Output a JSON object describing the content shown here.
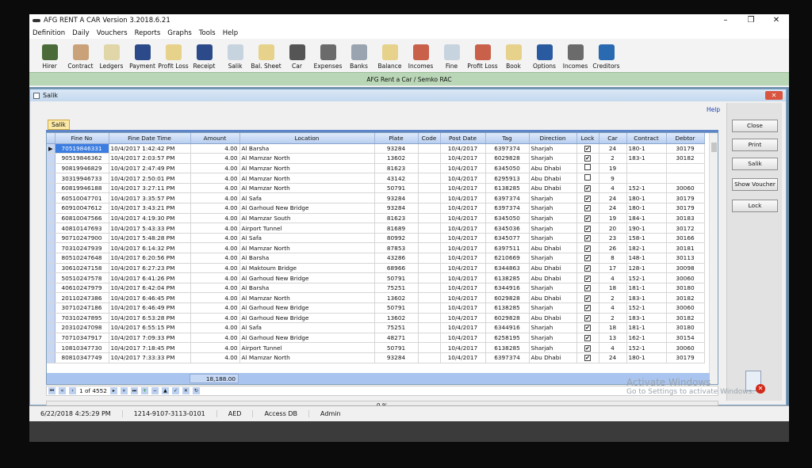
{
  "window": {
    "title": "AFG RENT A CAR Version 3.2018.6.21",
    "minimize": "–",
    "maximize": "❐",
    "close": "✕"
  },
  "menu": [
    "Definition",
    "Daily",
    "Vouchers",
    "Reports",
    "Graphs",
    "Tools",
    "Help"
  ],
  "toolbar": [
    {
      "label": "Hirer",
      "icon": "hirer-icon",
      "color": "#4a6a3a"
    },
    {
      "label": "Contract",
      "icon": "handshake-icon",
      "color": "#c9a27a"
    },
    {
      "label": "Ledgers",
      "icon": "ledger-icon",
      "color": "#e0d6a8"
    },
    {
      "label": "Payment",
      "icon": "payment-icon",
      "color": "#2c4a8a"
    },
    {
      "label": "Profit Loss",
      "icon": "folder-icon",
      "color": "#e6d28a"
    },
    {
      "label": "Receipt",
      "icon": "receipt-icon",
      "color": "#2c4a8a"
    },
    {
      "label": "Salik",
      "icon": "salik-icon",
      "color": "#c8d3e0"
    },
    {
      "label": "Bal. Sheet",
      "icon": "folder-icon",
      "color": "#e6d28a"
    },
    {
      "label": "Car",
      "icon": "car-icon",
      "color": "#555555"
    },
    {
      "label": "Expenses",
      "icon": "expenses-icon",
      "color": "#6b6b6b"
    },
    {
      "label": "Banks",
      "icon": "banks-icon",
      "color": "#9aa4b0"
    },
    {
      "label": "Balance",
      "icon": "folder-icon",
      "color": "#e6d28a"
    },
    {
      "label": "Incomes",
      "icon": "incomes-icon",
      "color": "#c9604a"
    },
    {
      "label": "Fine",
      "icon": "fine-icon",
      "color": "#c8d3e0"
    },
    {
      "label": "Profit Loss",
      "icon": "profit-loss-icon",
      "color": "#c9604a"
    },
    {
      "label": "Book",
      "icon": "book-icon",
      "color": "#e6d28a"
    },
    {
      "label": "Options",
      "icon": "options-icon",
      "color": "#2a5aa0"
    },
    {
      "label": "Incomes",
      "icon": "incomes-icon",
      "color": "#6b6b6b"
    },
    {
      "label": "Creditors",
      "icon": "creditors-icon",
      "color": "#2a6ab0"
    }
  ],
  "banner": "AFG Rent a Car / Semko RAC",
  "child": {
    "title": "Salik",
    "help": "Help",
    "tab": "Salik"
  },
  "grid": {
    "columns": [
      "Fine No",
      "Fine Date Time",
      "Amount",
      "Location",
      "Plate",
      "Code",
      "Post Date",
      "Tag",
      "Direction",
      "Lock",
      "Car",
      "Contract",
      "Debtor"
    ],
    "rows": [
      [
        "70519846331",
        "10/4/2017 1:42:42 PM",
        "4.00",
        "Al Barsha",
        "93284",
        "",
        "10/4/2017",
        "6397374",
        "Sharjah",
        true,
        "24",
        "180-1",
        "30179"
      ],
      [
        "90519846362",
        "10/4/2017 2:03:57 PM",
        "4.00",
        "Al Mamzar North",
        "13602",
        "",
        "10/4/2017",
        "6029828",
        "Sharjah",
        true,
        "2",
        "183-1",
        "30182"
      ],
      [
        "90819946829",
        "10/4/2017 2:47:49 PM",
        "4.00",
        "Al Mamzar North",
        "81623",
        "",
        "10/4/2017",
        "6345050",
        "Abu Dhabi",
        false,
        "19",
        "",
        ""
      ],
      [
        "30319946733",
        "10/4/2017 2:50:01 PM",
        "4.00",
        "Al Mamzar North",
        "43142",
        "",
        "10/4/2017",
        "6295913",
        "Abu Dhabi",
        false,
        "9",
        "",
        ""
      ],
      [
        "60819946188",
        "10/4/2017 3:27:11 PM",
        "4.00",
        "Al Mamzar North",
        "50791",
        "",
        "10/4/2017",
        "6138285",
        "Abu Dhabi",
        true,
        "4",
        "152-1",
        "30060"
      ],
      [
        "60510047701",
        "10/4/2017 3:35:57 PM",
        "4.00",
        "Al Safa",
        "93284",
        "",
        "10/4/2017",
        "6397374",
        "Sharjah",
        true,
        "24",
        "180-1",
        "30179"
      ],
      [
        "60910047612",
        "10/4/2017 3:43:21 PM",
        "4.00",
        "Al Garhoud New Bridge",
        "93284",
        "",
        "10/4/2017",
        "6397374",
        "Sharjah",
        true,
        "24",
        "180-1",
        "30179"
      ],
      [
        "60810047566",
        "10/4/2017 4:19:30 PM",
        "4.00",
        "Al Mamzar South",
        "81623",
        "",
        "10/4/2017",
        "6345050",
        "Sharjah",
        true,
        "19",
        "184-1",
        "30183"
      ],
      [
        "40810147693",
        "10/4/2017 5:43:33 PM",
        "4.00",
        "Airport Tunnel",
        "81689",
        "",
        "10/4/2017",
        "6345036",
        "Sharjah",
        true,
        "20",
        "190-1",
        "30172"
      ],
      [
        "90710247900",
        "10/4/2017 5:48:28 PM",
        "4.00",
        "Al Safa",
        "80992",
        "",
        "10/4/2017",
        "6345077",
        "Sharjah",
        true,
        "23",
        "158-1",
        "30166"
      ],
      [
        "70310247939",
        "10/4/2017 6:14:32 PM",
        "4.00",
        "Al Mamzar North",
        "87853",
        "",
        "10/4/2017",
        "6397511",
        "Abu Dhabi",
        true,
        "26",
        "182-1",
        "30181"
      ],
      [
        "80510247648",
        "10/4/2017 6:20:56 PM",
        "4.00",
        "Al Barsha",
        "43286",
        "",
        "10/4/2017",
        "6210669",
        "Sharjah",
        true,
        "8",
        "148-1",
        "30113"
      ],
      [
        "30610247158",
        "10/4/2017 6:27:23 PM",
        "4.00",
        "Al Maktoum Bridge",
        "68966",
        "",
        "10/4/2017",
        "6344863",
        "Abu Dhabi",
        true,
        "17",
        "128-1",
        "30098"
      ],
      [
        "50510247578",
        "10/4/2017 6:41:26 PM",
        "4.00",
        "Al Garhoud New Bridge",
        "50791",
        "",
        "10/4/2017",
        "6138285",
        "Abu Dhabi",
        true,
        "4",
        "152-1",
        "30060"
      ],
      [
        "40610247979",
        "10/4/2017 6:42:04 PM",
        "4.00",
        "Al Barsha",
        "75251",
        "",
        "10/4/2017",
        "6344916",
        "Sharjah",
        true,
        "18",
        "181-1",
        "30180"
      ],
      [
        "20110247386",
        "10/4/2017 6:46:45 PM",
        "4.00",
        "Al Mamzar North",
        "13602",
        "",
        "10/4/2017",
        "6029828",
        "Abu Dhabi",
        true,
        "2",
        "183-1",
        "30182"
      ],
      [
        "30710247186",
        "10/4/2017 6:46:49 PM",
        "4.00",
        "Al Garhoud New Bridge",
        "50791",
        "",
        "10/4/2017",
        "6138285",
        "Sharjah",
        true,
        "4",
        "152-1",
        "30060"
      ],
      [
        "70310247895",
        "10/4/2017 6:53:28 PM",
        "4.00",
        "Al Garhoud New Bridge",
        "13602",
        "",
        "10/4/2017",
        "6029828",
        "Abu Dhabi",
        true,
        "2",
        "183-1",
        "30182"
      ],
      [
        "20310247098",
        "10/4/2017 6:55:15 PM",
        "4.00",
        "Al Safa",
        "75251",
        "",
        "10/4/2017",
        "6344916",
        "Sharjah",
        true,
        "18",
        "181-1",
        "30180"
      ],
      [
        "70710347917",
        "10/4/2017 7:09:33 PM",
        "4.00",
        "Al Garhoud New Bridge",
        "48271",
        "",
        "10/4/2017",
        "6258195",
        "Sharjah",
        true,
        "13",
        "162-1",
        "30154"
      ],
      [
        "10810347730",
        "10/4/2017 7:18:45 PM",
        "4.00",
        "Airport Tunnel",
        "50791",
        "",
        "10/4/2017",
        "6138285",
        "Sharjah",
        true,
        "4",
        "152-1",
        "30060"
      ],
      [
        "80810347749",
        "10/4/2017 7:33:33 PM",
        "4.00",
        "Al Mamzar North",
        "93284",
        "",
        "10/4/2017",
        "6397374",
        "Abu Dhabi",
        true,
        "24",
        "180-1",
        "30179"
      ]
    ],
    "total_amount": "18,188.00"
  },
  "navigator": {
    "position": "1 of 4552"
  },
  "progress": {
    "label": "0 %",
    "value": 0
  },
  "buttons": {
    "close": "Close",
    "print": "Print",
    "salik": "Salik",
    "show_voucher": "Show Voucher",
    "lock": "Lock"
  },
  "watermark": {
    "line1": "Activate Windows",
    "line2": "Go to Settings to activate Windows."
  },
  "status": {
    "datetime": "6/22/2018 4:25:29 PM",
    "serial": "1214-9107-3113-0101",
    "currency": "AED",
    "db": "Access DB",
    "user": "Admin"
  }
}
